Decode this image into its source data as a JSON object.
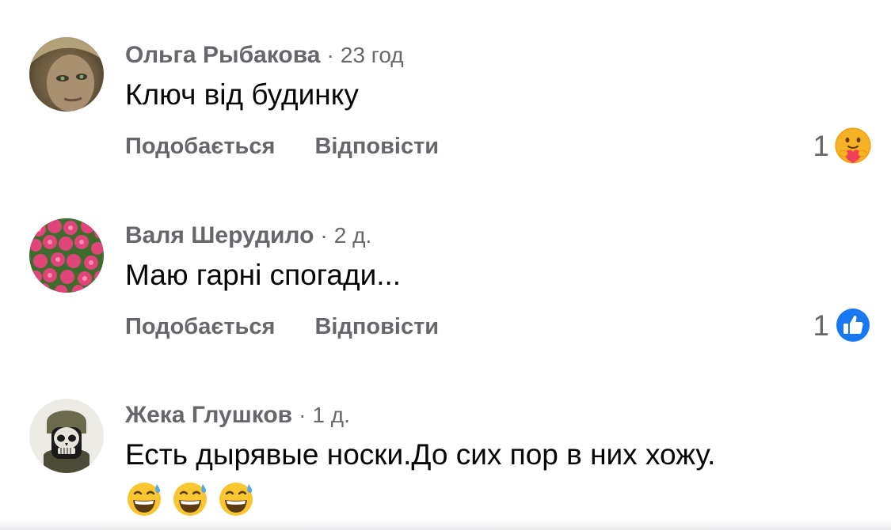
{
  "comments": [
    {
      "author": "Ольга Рыбакова",
      "time": "23 год",
      "text": "Ключ від будинку",
      "like_label": "Подобається",
      "reply_label": "Відповісти",
      "reaction_count": "1",
      "reaction_icon": "care-icon"
    },
    {
      "author": "Валя Шерудило",
      "time": "2 д.",
      "text": "Маю гарні спогади...",
      "like_label": "Подобається",
      "reply_label": "Відповісти",
      "reaction_count": "1",
      "reaction_icon": "like-icon"
    },
    {
      "author": "Жека Глушков",
      "time": "1 д.",
      "text": "Есть дырявые носки.До сих пор в них хожу.",
      "emojis": [
        "grinning-sweat-emoji",
        "grinning-sweat-emoji",
        "grinning-sweat-emoji"
      ]
    }
  ],
  "separator": "·",
  "colors": {
    "secondary_text": "#65676b",
    "primary_text": "#050505",
    "like_blue": "#1877f2",
    "care_yellow": "#f7b125"
  }
}
